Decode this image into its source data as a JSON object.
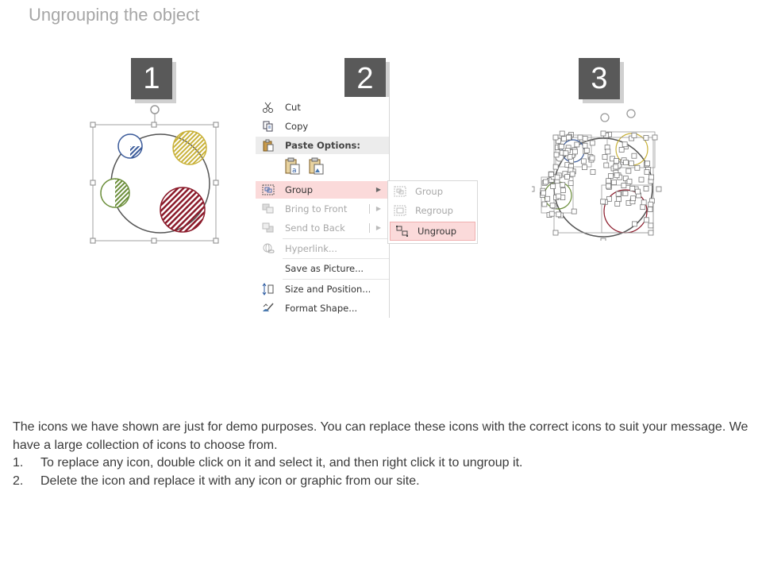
{
  "title": "Ungrouping the object",
  "steps": [
    "1",
    "2",
    "3"
  ],
  "context_menu": {
    "items": [
      {
        "label": "Cut",
        "icon": "scissors-icon"
      },
      {
        "label": "Copy",
        "icon": "copy-icon"
      },
      {
        "label": "Paste Options:",
        "icon": "paste-icon"
      },
      {
        "label": "Group",
        "icon": "group-icon"
      },
      {
        "label": "Bring to Front",
        "icon": "bring-to-front-icon"
      },
      {
        "label": "Send to Back",
        "icon": "send-to-back-icon"
      },
      {
        "label": "Hyperlink...",
        "icon": "hyperlink-icon"
      },
      {
        "label": "Save as Picture...",
        "icon": ""
      },
      {
        "label": "Size and Position...",
        "icon": "size-position-icon"
      },
      {
        "label": "Format Shape...",
        "icon": "format-shape-icon"
      }
    ]
  },
  "submenu": {
    "items": [
      {
        "label": "Group",
        "icon": "group-icon"
      },
      {
        "label": "Regroup",
        "icon": "regroup-icon"
      },
      {
        "label": "Ungroup",
        "icon": "ungroup-icon"
      }
    ]
  },
  "body": {
    "intro": "The icons we have shown are just for demo purposes. You can replace these icons with the correct icons to suit your message. We have a large collection of icons to choose from.",
    "list": [
      {
        "num": "1.",
        "text": "To replace any icon, double click on it and select it, and then right click it to ungroup it."
      },
      {
        "num": "2.",
        "text": "Delete the icon and replace it with any icon or graphic from our site."
      }
    ]
  },
  "colors": {
    "blue": "#3b5b9a",
    "yellow": "#c9b23a",
    "green": "#6b8e3a",
    "red": "#8b1a2a",
    "badge": "#595959",
    "highlight": "#fbdada"
  }
}
